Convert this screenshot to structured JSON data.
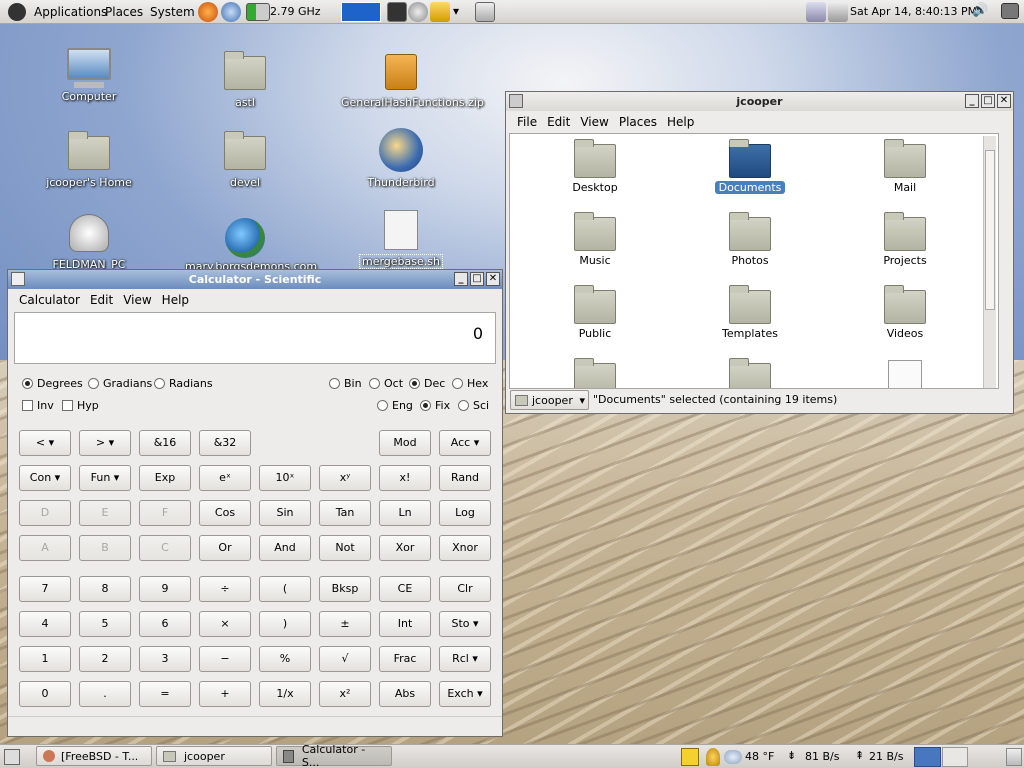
{
  "top_panel": {
    "menus": [
      "Applications",
      "Places",
      "System"
    ],
    "cpu_freq": "2.79 GHz",
    "clock": "Sat Apr 14,  8:40:13 PM"
  },
  "desktop_icons": [
    {
      "label": "Computer"
    },
    {
      "label": "astl"
    },
    {
      "label": "GeneralHashFunctions.zip"
    },
    {
      "label": "jcooper's Home"
    },
    {
      "label": "devel"
    },
    {
      "label": "Thunderbird"
    },
    {
      "label": "FELDMAN_PC"
    },
    {
      "label": "mary.borgsdemons.com"
    },
    {
      "label": "mergebase.sh"
    }
  ],
  "calculator": {
    "title": "Calculator - Scientific",
    "menus": [
      "Calculator",
      "Edit",
      "View",
      "Help"
    ],
    "display": "0",
    "angle_modes": [
      "Degrees",
      "Gradians",
      "Radians"
    ],
    "bases": [
      "Bin",
      "Oct",
      "Dec",
      "Hex"
    ],
    "checks": [
      "Inv",
      "Hyp"
    ],
    "formats": [
      "Eng",
      "Fix",
      "Sci"
    ],
    "rows": [
      [
        "<",
        ">",
        "&16",
        "&32",
        "",
        "",
        "Mod",
        "Acc"
      ],
      [
        "Con",
        "Fun",
        "Exp",
        "eˣ",
        "10ˣ",
        "xʸ",
        "x!",
        "Rand"
      ],
      [
        "D",
        "E",
        "F",
        "Cos",
        "Sin",
        "Tan",
        "Ln",
        "Log"
      ],
      [
        "A",
        "B",
        "C",
        "Or",
        "And",
        "Not",
        "Xor",
        "Xnor"
      ],
      [
        "7",
        "8",
        "9",
        "÷",
        "(",
        "Bksp",
        "CE",
        "Clr"
      ],
      [
        "4",
        "5",
        "6",
        "×",
        ")",
        "±",
        "Int",
        "Sto"
      ],
      [
        "1",
        "2",
        "3",
        "−",
        "%",
        "√",
        "Frac",
        "Rcl"
      ],
      [
        "0",
        ".",
        "=",
        "+",
        "1/x",
        "x²",
        "Abs",
        "Exch"
      ]
    ]
  },
  "file_manager": {
    "title": "jcooper",
    "menus": [
      "File",
      "Edit",
      "View",
      "Places",
      "Help"
    ],
    "items": [
      "Desktop",
      "Documents",
      "Mail",
      "Music",
      "Photos",
      "Projects",
      "Public",
      "Templates",
      "Videos"
    ],
    "location": "jcooper",
    "status": "\"Documents\" selected (containing 19 items)"
  },
  "bottom_panel": {
    "tasks": [
      "[FreeBSD - T...",
      "jcooper",
      "Calculator - S..."
    ],
    "weather": "48 °F",
    "net_down": "81 B/s",
    "net_up": "21 B/s"
  }
}
